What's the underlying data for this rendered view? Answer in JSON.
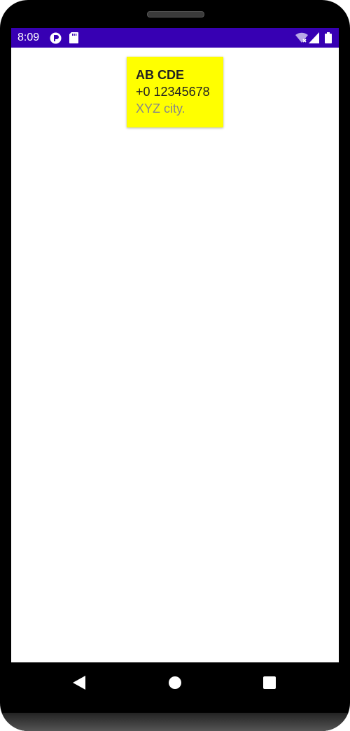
{
  "status_bar": {
    "time": "8:09",
    "icons": [
      "app-notification-icon",
      "sd-card-icon",
      "wifi-icon",
      "signal-icon",
      "battery-icon"
    ],
    "color": "#3700b3"
  },
  "card": {
    "name": "AB CDE",
    "phone": "+0 12345678",
    "city": "XYZ city.",
    "background": "#ffff00"
  },
  "navigation": {
    "buttons": [
      "back-icon",
      "home-icon",
      "recents-icon"
    ]
  }
}
